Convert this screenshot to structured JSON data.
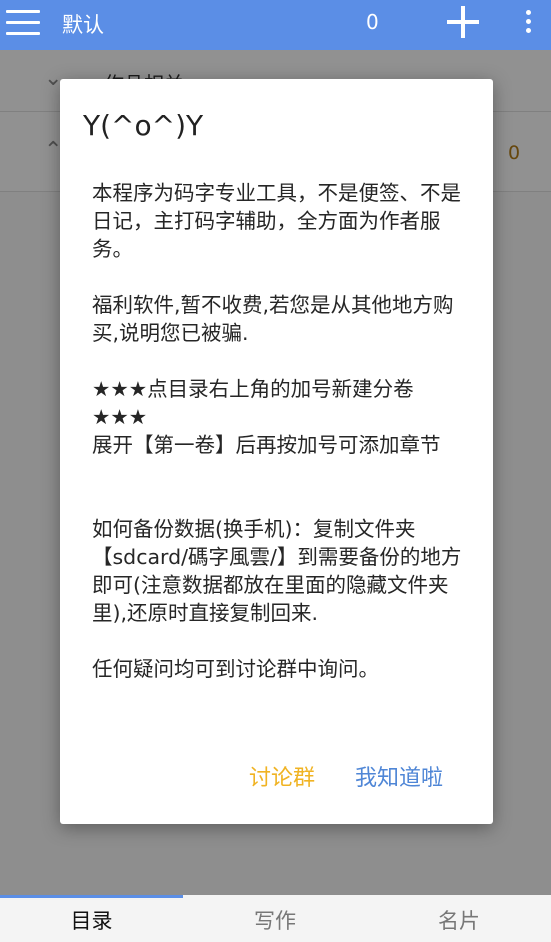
{
  "appbar": {
    "title": "默认",
    "count": "0",
    "icons": [
      "menu-icon",
      "add-icon",
      "more-vertical-icon"
    ]
  },
  "list": {
    "row1": {
      "label": "作品相关"
    },
    "row2": {
      "count": "0"
    }
  },
  "dialog": {
    "title": "Y(^o^)Y",
    "paragraphs": [
      "本程序为码字专业工具，不是便签、不是日记，主打码字辅助，全方面为作者服务。",
      "福利软件,暂不收费,若您是从其他地方购买,说明您已被骗.",
      "★★★点目录右上角的加号新建分卷★★★\n展开【第一卷】后再按加号可添加章节",
      "如何备份数据(换手机)：复制文件夹【sdcard/碼字風雲/】到需要备份的地方即可(注意数据都放在里面的隐藏文件夹里),还原时直接复制回来.",
      "任何疑问均可到讨论群中询问。"
    ],
    "buttons": {
      "group": "讨论群",
      "ok": "我知道啦"
    }
  },
  "tabs": [
    "目录",
    "写作",
    "名片"
  ],
  "colors": {
    "primary": "#5b8ee6",
    "accent_yellow": "#f0b323",
    "accent_blue": "#4f86d6",
    "count_orange": "#b07a18"
  }
}
